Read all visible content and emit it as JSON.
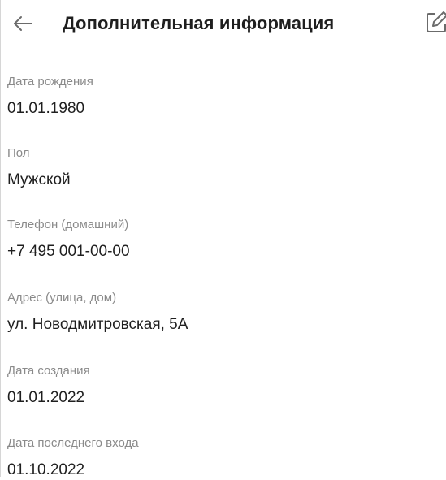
{
  "header": {
    "title": "Дополнительная информация",
    "back_icon": "arrow-left-icon",
    "edit_icon": "edit-icon"
  },
  "fields": [
    {
      "label": "Дата рождения",
      "value": "01.01.1980"
    },
    {
      "label": "Пол",
      "value": "Мужской"
    },
    {
      "label": "Телефон (домашний)",
      "value": "+7 495 001-00-00"
    },
    {
      "label": "Адрес (улица, дом)",
      "value": "ул. Новодмитровская, 5А"
    },
    {
      "label": "Дата создания",
      "value": "01.01.2022"
    },
    {
      "label": "Дата последнего входа",
      "value": "01.10.2022"
    }
  ],
  "colors": {
    "label": "#8a8a8a",
    "value": "#1f1f1f",
    "icon": "#6b6b6b"
  }
}
